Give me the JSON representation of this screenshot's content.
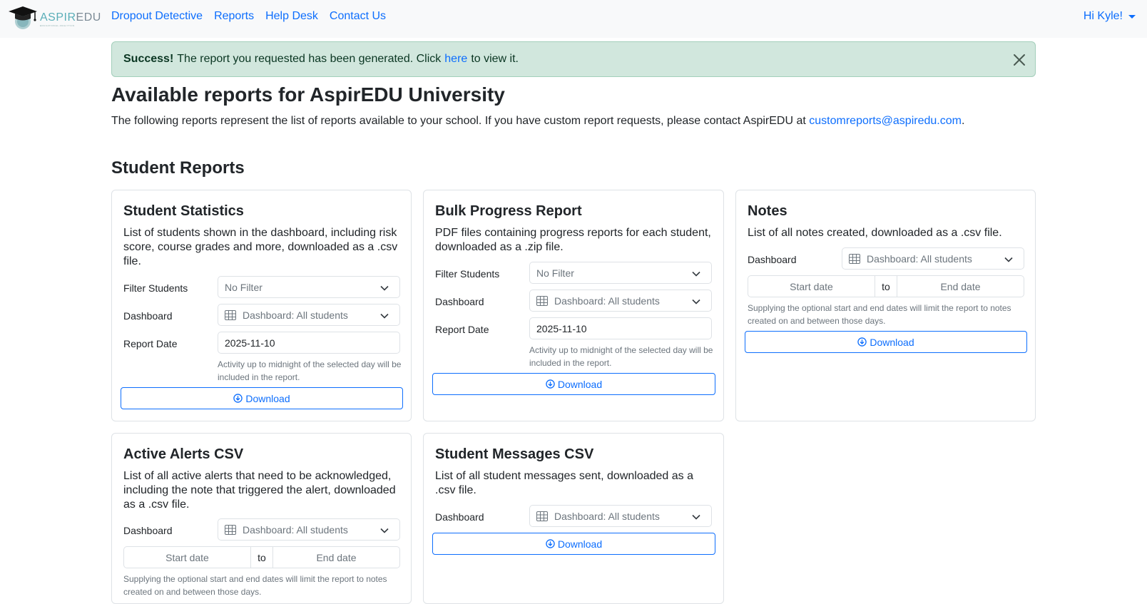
{
  "navbar": {
    "brand": {
      "name_part1": "ASPIR",
      "name_part2": "EDU",
      "tagline": "EDUCATIONAL ANALYTICS"
    },
    "links": [
      "Dropout Detective",
      "Reports",
      "Help Desk",
      "Contact Us"
    ],
    "user_greeting": "Hi Kyle!"
  },
  "alert": {
    "strong": "Success!",
    "text_before": "The report you requested has been generated. Click",
    "link": "here",
    "text_after": "to view it."
  },
  "page": {
    "title": "Available reports for AspirEDU University",
    "intro_text": "The following reports represent the list of reports available to your school. If you have custom report requests, please contact AspirEDU at",
    "intro_email": "customreports@aspiredu.com",
    "intro_end": "."
  },
  "section": {
    "title": "Student Reports"
  },
  "common": {
    "filter_label": "Filter Students",
    "dashboard_label": "Dashboard",
    "report_date_label": "Report Date",
    "filter_value": "No Filter",
    "dashboard_value": "Dashboard: All students",
    "report_date_value": "2025-11-10",
    "report_date_help": "Activity up to midnight of the selected day will be included in the report.",
    "start_placeholder": "Start date",
    "end_placeholder": "End date",
    "to_text": "to",
    "range_help": "Supplying the optional start and end dates will limit the report to notes created on and between those days.",
    "download_label": "Download"
  },
  "cards": {
    "student_statistics": {
      "title": "Student Statistics",
      "description": "List of students shown in the dashboard, including risk score, course grades and more, downloaded as a .csv file."
    },
    "bulk_progress": {
      "title": "Bulk Progress Report",
      "description": "PDF files containing progress reports for each student, downloaded as a .zip file."
    },
    "notes": {
      "title": "Notes",
      "description": "List of all notes created, downloaded as a .csv file."
    },
    "active_alerts": {
      "title": "Active Alerts CSV",
      "description": "List of all active alerts that need to be acknowledged, including the note that triggered the alert, downloaded as a .csv file."
    },
    "student_messages": {
      "title": "Student Messages CSV",
      "description": "List of all student messages sent, downloaded as a .csv file."
    }
  },
  "colors": {
    "link": "#0d6efd",
    "alert_bg": "#d1e7dd",
    "navbar_bg": "#f8f9fa",
    "brand_teal": "#5aaeb8"
  }
}
